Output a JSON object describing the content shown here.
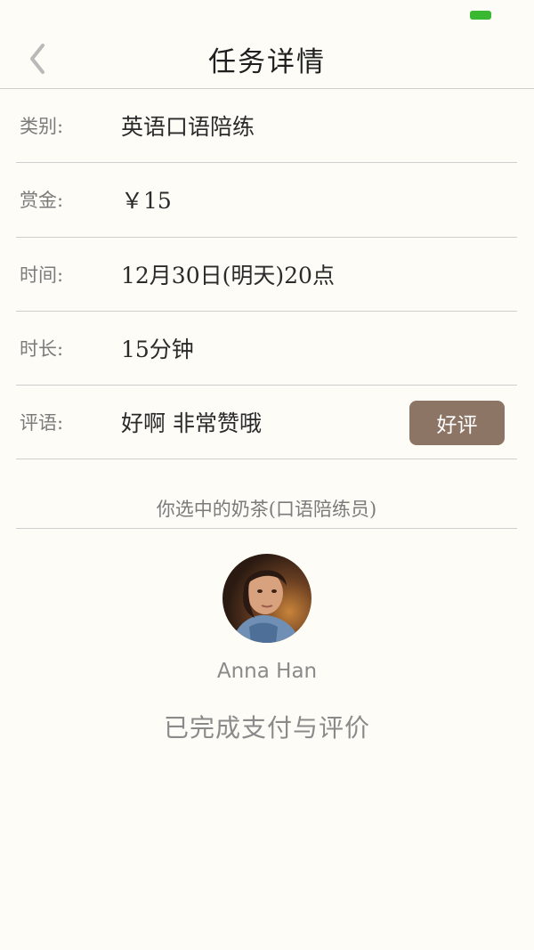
{
  "colors": {
    "accent_brown": "#8d7565",
    "battery_green": "#3bb832",
    "divider": "#cfcfcf",
    "background": "#fdfcf6"
  },
  "nav": {
    "back_icon": "chevron-left-icon",
    "title": "任务详情"
  },
  "details": [
    {
      "label": "类别:",
      "value": "英语口语陪练"
    },
    {
      "label": "赏金:",
      "value": "￥15"
    },
    {
      "label": "时间:",
      "value": "12月30日(明天)20点"
    },
    {
      "label": "时长:",
      "value": "15分钟"
    },
    {
      "label": "评语:",
      "value": "好啊 非常赞哦"
    }
  ],
  "rate_button_label": "好评",
  "section_title": "你选中的奶茶(口语陪练员)",
  "profile": {
    "name": "Anna Han"
  },
  "status_message": "已完成支付与评价"
}
